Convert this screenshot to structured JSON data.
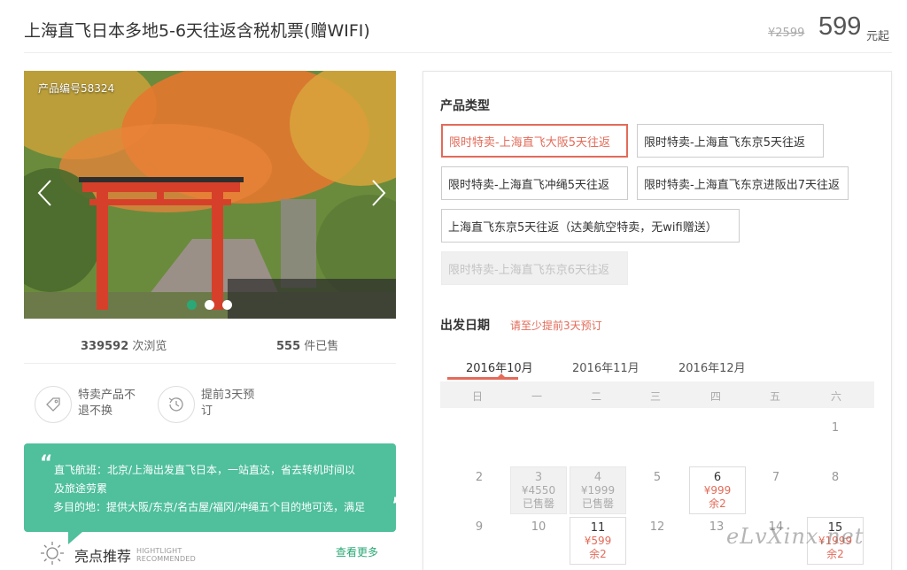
{
  "header": {
    "title": "上海直飞日本多地5-6天往返含税机票(赠WIFI)",
    "original_price": "¥2599",
    "price": "599",
    "price_unit": "元起"
  },
  "gallery": {
    "product_code": "产品编号58324",
    "slide_count": 3,
    "active_slide": 1
  },
  "stats": {
    "views_count": "339592",
    "views_label": "次浏览",
    "sold_count": "555",
    "sold_label": "件已售"
  },
  "features": [
    {
      "icon": "tag-icon",
      "label": "特卖产品不退不换"
    },
    {
      "icon": "history-clock-icon",
      "label": "提前3天预订"
    }
  ],
  "quote": {
    "line1": "直飞航班：北京/上海出发直飞日本，一站直达，省去转机时间以",
    "line2": "及旅途劳累",
    "line3": "多目的地：提供大阪/东京/名古屋/福冈/冲绳五个目的地可选，满足"
  },
  "highlights": {
    "title": "亮点推荐",
    "subtitle_1": "HIGHTLIGHT",
    "subtitle_2": "RECOMMENDED",
    "see_more": "查看更多"
  },
  "product_types": {
    "heading": "产品类型",
    "options": [
      {
        "label": "限时特卖-上海直飞大阪5天往返",
        "state": "selected"
      },
      {
        "label": "限时特卖-上海直飞东京5天往返",
        "state": "normal"
      },
      {
        "label": "限时特卖-上海直飞冲绳5天往返",
        "state": "normal"
      },
      {
        "label": "限时特卖-上海直飞东京进阪出7天往返",
        "state": "normal"
      },
      {
        "label": "上海直飞东京5天往返（达美航空特卖，无wifi赠送）",
        "state": "normal"
      },
      {
        "label": "限时特卖-上海直飞东京6天往返",
        "state": "disabled"
      }
    ]
  },
  "departure": {
    "heading": "出发日期",
    "note": "请至少提前3天预订",
    "months": [
      "2016年10月",
      "2016年11月",
      "2016年12月"
    ],
    "active_month": "2016年10月",
    "weekdays": [
      "日",
      "一",
      "二",
      "三",
      "四",
      "五",
      "六"
    ],
    "days": [
      {
        "num": "1",
        "state": "plain"
      },
      {
        "num": "2",
        "state": "plain"
      },
      {
        "num": "3",
        "state": "soldout",
        "price": "¥4550",
        "status": "已售罄"
      },
      {
        "num": "4",
        "state": "soldout",
        "price": "¥1999",
        "status": "已售罄"
      },
      {
        "num": "5",
        "state": "plain"
      },
      {
        "num": "6",
        "state": "available",
        "price": "¥999",
        "status": "余2"
      },
      {
        "num": "7",
        "state": "plain"
      },
      {
        "num": "8",
        "state": "plain"
      },
      {
        "num": "9",
        "state": "plain"
      },
      {
        "num": "10",
        "state": "plain"
      },
      {
        "num": "11",
        "state": "available",
        "price": "¥599",
        "status": "余2"
      },
      {
        "num": "12",
        "state": "plain"
      },
      {
        "num": "13",
        "state": "plain"
      },
      {
        "num": "14",
        "state": "plain"
      },
      {
        "num": "15",
        "state": "available",
        "price": "¥1999",
        "status": "余2"
      }
    ]
  },
  "watermark": "eLvXinx.net",
  "colors": {
    "accent_red": "#e36b59",
    "accent_green": "#2aa876",
    "quote_bg": "#4fbf9c"
  }
}
